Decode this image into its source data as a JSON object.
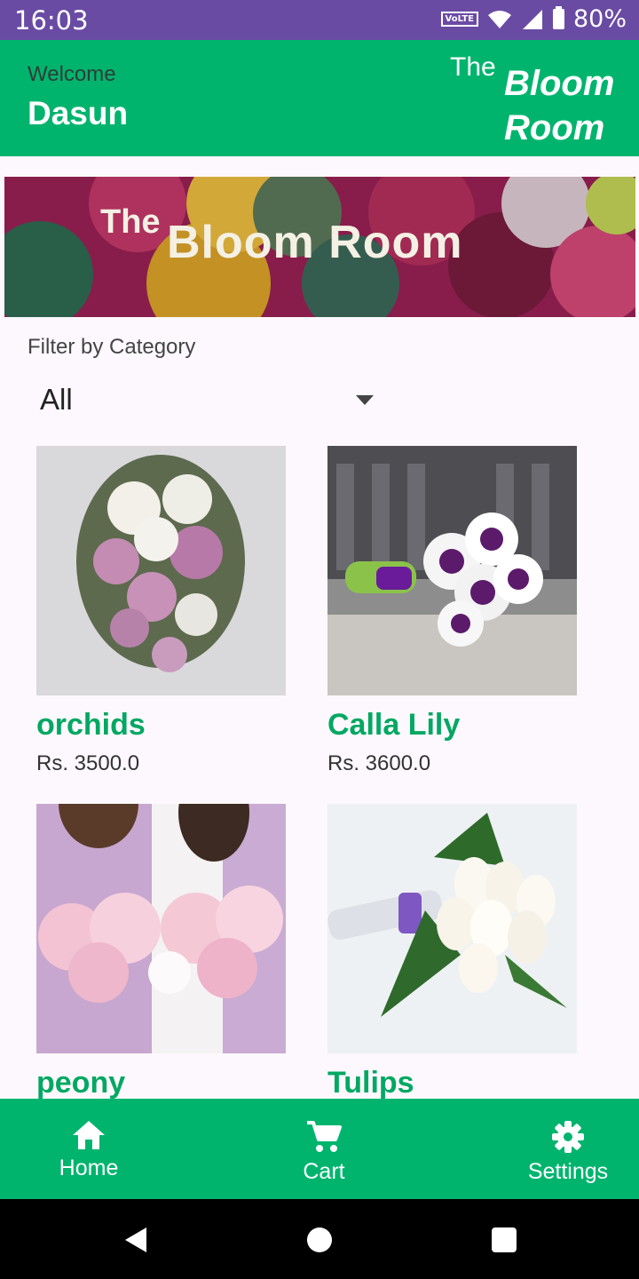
{
  "status_bar": {
    "time": "16:03",
    "volte": "VoLTE",
    "battery": "80%",
    "icons": [
      "wifi-icon",
      "signal-icon",
      "battery-icon"
    ]
  },
  "header": {
    "welcome": "Welcome",
    "username": "Dasun",
    "brand_the": "The",
    "brand_line1": "Bloom",
    "brand_line2": "Room"
  },
  "banner": {
    "the": "The",
    "title": "Bloom Room"
  },
  "filter": {
    "label": "Filter by Category",
    "selected": "All"
  },
  "products": [
    {
      "name": "orchids",
      "price": "Rs. 3500.0"
    },
    {
      "name": "Calla Lily",
      "price": "Rs. 3600.0"
    },
    {
      "name": "peony",
      "price": ""
    },
    {
      "name": "Tulips",
      "price": ""
    }
  ],
  "bottom_nav": {
    "home": "Home",
    "cart": "Cart",
    "settings": "Settings"
  },
  "colors": {
    "status_bar": "#6a4ba4",
    "primary": "#00b46e",
    "product_name": "#00a862"
  }
}
